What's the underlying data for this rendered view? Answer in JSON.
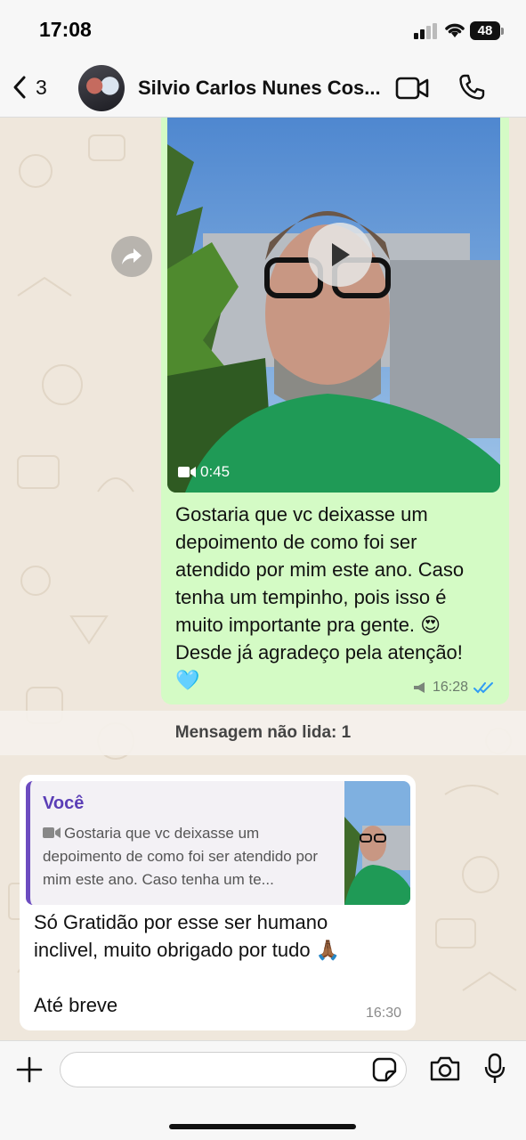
{
  "status_bar": {
    "time": "17:08",
    "battery": "48"
  },
  "header": {
    "back_count": "3",
    "contact_name": "Silvio Carlos Nunes Cos...",
    "icons": [
      "chevron-left-icon",
      "video-call-icon",
      "phone-icon"
    ]
  },
  "outgoing_message": {
    "video_duration": "0:45",
    "text_lines": [
      "Gostaria que vc deixasse um",
      "depoimento de como foi ser",
      "atendido por mim este ano. Caso",
      "tenha um tempinho, pois isso é",
      "muito importante pra gente. 😍",
      "Desde já agradeço pela atenção!",
      "🩵"
    ],
    "time": "16:28",
    "status": "read"
  },
  "unread_banner": "Mensagem não lida: 1",
  "incoming_message": {
    "quote_author": "Você",
    "quote_text": "Gostaria que vc deixasse um depoimento de como foi ser atendido por mim este ano. Caso tenha um te...",
    "text_lines": [
      "Só Gratidão por esse ser humano",
      "inclivel, muito obrigado por tudo 🙏🏾"
    ],
    "text_last": "Até breve",
    "time": "16:30"
  },
  "input": {
    "placeholder": ""
  },
  "colors": {
    "outgoing_bubble": "#d4fbc5",
    "accent_purple": "#5b3eb6",
    "read_ticks": "#2f9cf4"
  }
}
